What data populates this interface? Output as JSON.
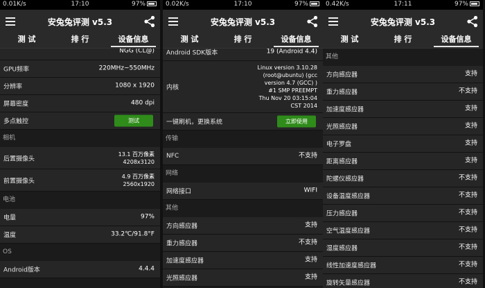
{
  "screens": [
    {
      "status": {
        "speed": "0.01K/s",
        "time": "17:10",
        "battery": "97%"
      },
      "title": "安兔兔评测 v5.3",
      "tabs": [
        "测 试",
        "排 行",
        "设备信息"
      ],
      "rows": [
        {
          "type": "row",
          "label": "",
          "value": "NGG (CL@)"
        },
        {
          "type": "row",
          "label": "GPU频率",
          "value": "220MHz~550MHz"
        },
        {
          "type": "row",
          "label": "分辨率",
          "value": "1080 x 1920"
        },
        {
          "type": "row",
          "label": "屏幕密度",
          "value": "480 dpi"
        },
        {
          "type": "button",
          "label": "多点触控",
          "button": "测试"
        },
        {
          "type": "section",
          "label": "相机"
        },
        {
          "type": "tall",
          "label": "后置摄像头",
          "value": "13.1 百万像素\n4208x3120"
        },
        {
          "type": "tall",
          "label": "前置摄像头",
          "value": "4.9 百万像素\n2560x1920"
        },
        {
          "type": "section",
          "label": "电池"
        },
        {
          "type": "row",
          "label": "电量",
          "value": "97%"
        },
        {
          "type": "row",
          "label": "温度",
          "value": "33.2℃/91.8°F"
        },
        {
          "type": "section",
          "label": "OS"
        },
        {
          "type": "row",
          "label": "Android版本",
          "value": "4.4.4"
        }
      ]
    },
    {
      "status": {
        "speed": "0.02K/s",
        "time": "17:10",
        "battery": "97%"
      },
      "title": "安兔兔评测 v5.3",
      "tabs": [
        "测 试",
        "排 行",
        "设备信息"
      ],
      "rows": [
        {
          "type": "row",
          "label": "Android SDK版本",
          "value": "19  (Android 4.4)"
        },
        {
          "type": "kernel",
          "label": "内核",
          "value": "Linux version 3.10.28\n(root@ubuntu) (gcc\nversion 4.7 (GCC) )\n#1 SMP PREEMPT\nThu Nov 20 03:15:04\nCST 2014"
        },
        {
          "type": "button",
          "label": "一键刷机，更换系统",
          "button": "立即使用"
        },
        {
          "type": "section",
          "label": "传输"
        },
        {
          "type": "row",
          "label": "NFC",
          "value": "不支持"
        },
        {
          "type": "section",
          "label": "网络"
        },
        {
          "type": "row",
          "label": "网络接口",
          "value": "WIFI"
        },
        {
          "type": "section",
          "label": "其他"
        },
        {
          "type": "row",
          "label": "方向感应器",
          "value": "支持"
        },
        {
          "type": "row",
          "label": "重力感应器",
          "value": "不支持"
        },
        {
          "type": "row",
          "label": "加速度感应器",
          "value": "支持"
        },
        {
          "type": "row",
          "label": "光照感应器",
          "value": "支持"
        }
      ]
    },
    {
      "status": {
        "speed": "0.42K/s",
        "time": "17:11",
        "battery": "97%"
      },
      "title": "安兔兔评测 v5.3",
      "tabs": [
        "测 试",
        "排 行",
        "设备信息"
      ],
      "rows": [
        {
          "type": "section",
          "label": "其他"
        },
        {
          "type": "row",
          "label": "方向感应器",
          "value": "支持"
        },
        {
          "type": "row",
          "label": "重力感应器",
          "value": "不支持"
        },
        {
          "type": "row",
          "label": "加速度感应器",
          "value": "支持"
        },
        {
          "type": "row",
          "label": "光照感应器",
          "value": "支持"
        },
        {
          "type": "row",
          "label": "电子罗盘",
          "value": "支持"
        },
        {
          "type": "row",
          "label": "距离感应器",
          "value": "支持"
        },
        {
          "type": "row",
          "label": "陀螺仪感应器",
          "value": "不支持"
        },
        {
          "type": "row",
          "label": "设备温度感应器",
          "value": "不支持"
        },
        {
          "type": "row",
          "label": "压力感应器",
          "value": "不支持"
        },
        {
          "type": "row",
          "label": "空气温度感应器",
          "value": "不支持"
        },
        {
          "type": "row",
          "label": "湿度感应器",
          "value": "不支持"
        },
        {
          "type": "row",
          "label": "线性加速度感应器",
          "value": "不支持"
        },
        {
          "type": "row",
          "label": "旋转矢量感应器",
          "value": "不支持"
        }
      ]
    }
  ]
}
